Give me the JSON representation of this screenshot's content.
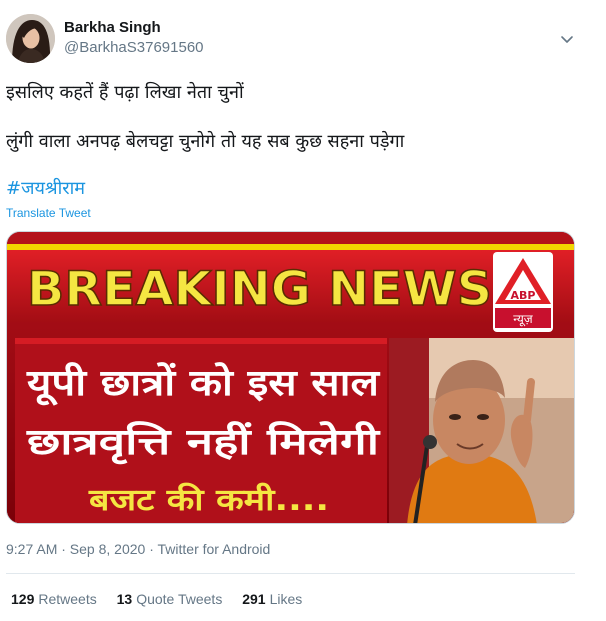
{
  "tweet": {
    "author": {
      "name": "Barkha Singh",
      "handle": "@BarkhaS37691560"
    },
    "text_lines": [
      "इसलिए कहतें हैं पढ़ा लिखा नेता चुनों",
      "लुंगी वाला अनपढ़ बेलचट्टा चुनोगे तो यह सब कुछ सहना पड़ेगा"
    ],
    "hashtag": "#जयश्रीराम",
    "translate_label": "Translate Tweet",
    "media": {
      "banner": "BREAKING NEWS",
      "headline_line1": "यूपी छात्रों को इस साल",
      "headline_line2": "छात्रवृत्ति नहीं मिलेगी",
      "subline": "बजट की कमी....",
      "logo_text": "ABP",
      "logo_subtext": "न्यूज़"
    },
    "timestamp": "9:27 AM · Sep 8, 2020 · Twitter for Android",
    "stats": {
      "retweets_count": "129",
      "retweets_label": "Retweets",
      "quotes_count": "13",
      "quotes_label": "Quote Tweets",
      "likes_count": "291",
      "likes_label": "Likes"
    }
  },
  "colors": {
    "link_blue": "#1b95e0",
    "secondary_gray": "#657786",
    "banner_red": "#c8102e",
    "banner_yellow": "#f5e642"
  }
}
